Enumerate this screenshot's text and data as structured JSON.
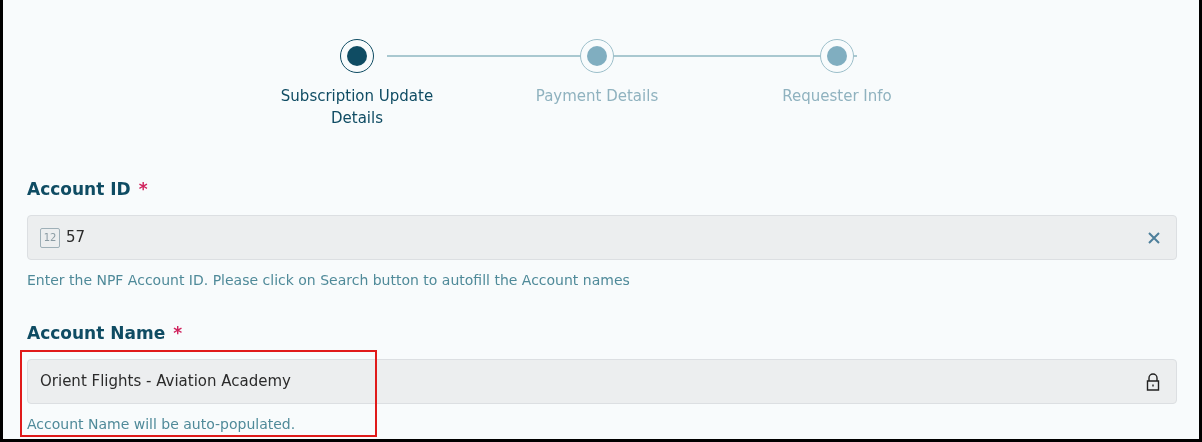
{
  "steps": [
    {
      "label": "Subscription Update Details",
      "selected": true
    },
    {
      "label": "Payment Details",
      "selected": false
    },
    {
      "label": "Requester Info",
      "selected": false
    }
  ],
  "fields": [
    {
      "label": "Account ID",
      "required_mark": "*",
      "kind": "number",
      "value": "57",
      "badge": "12",
      "help": "Enter the NPF Account ID. Please click on Search button to autofill the Account names",
      "highlighted": false
    },
    {
      "label": "Account Name",
      "required_mark": "*",
      "kind": "locked",
      "value": "Orient Flights - Aviation Academy",
      "help": "Account Name will be auto-populated.",
      "highlighted": true
    }
  ]
}
